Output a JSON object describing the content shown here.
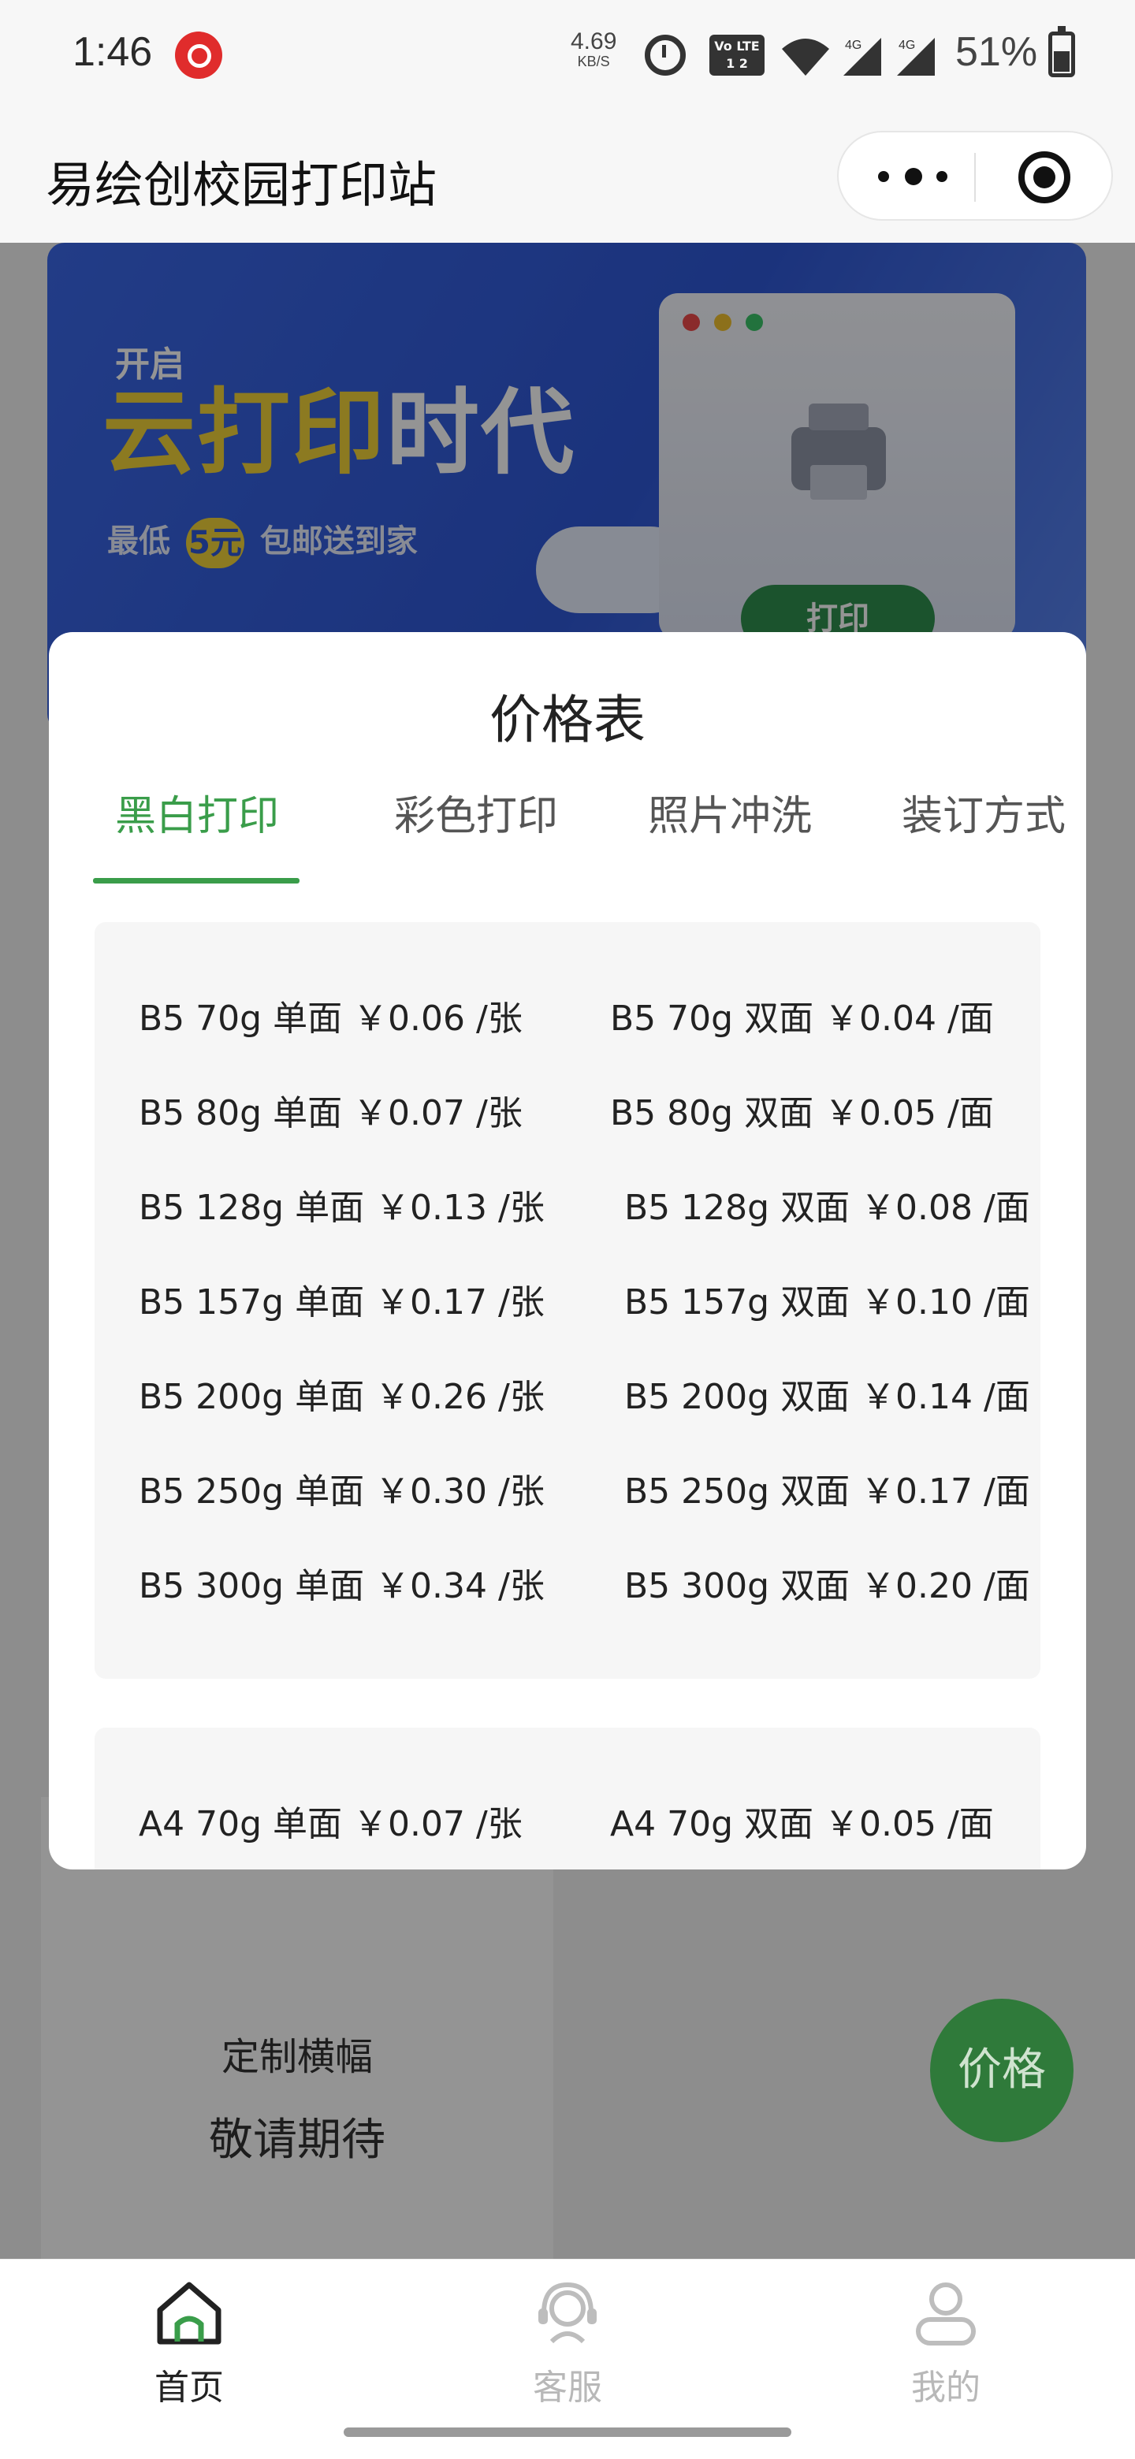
{
  "status_bar": {
    "time": "1:46",
    "net_speed": "4.69",
    "net_speed_unit": "KB/S",
    "volte_label": "Vo LTE 1 2",
    "signal_label_1": "4G",
    "signal_label_2": "4G",
    "battery": "51%"
  },
  "nav": {
    "title": "易绘创校园打印站"
  },
  "banner": {
    "small_text": "开启",
    "headline_highlight": "云打印",
    "headline_rest": "时代",
    "sub_prefix": "最低",
    "sub_coin": "5元",
    "sub_suffix": "包邮送到家",
    "print_button": "打印"
  },
  "background_card": {
    "title": "定制横幅",
    "subtitle": "敬请期待"
  },
  "modal": {
    "title": "价格表",
    "tabs": [
      {
        "label": "黑白打印",
        "active": true
      },
      {
        "label": "彩色打印",
        "active": false
      },
      {
        "label": "照片冲洗",
        "active": false
      },
      {
        "label": "装订方式",
        "active": false
      }
    ],
    "b5_rows": [
      {
        "single": "B5 70g 单面 ￥0.06 /张",
        "double": "B5 70g 双面 ￥0.04 /面"
      },
      {
        "single": "B5 80g 单面 ￥0.07 /张",
        "double": "B5 80g 双面 ￥0.05 /面"
      },
      {
        "single": "B5 128g 单面 ￥0.13 /张",
        "double": "B5 128g 双面 ￥0.08 /面"
      },
      {
        "single": "B5 157g 单面 ￥0.17 /张",
        "double": "B5 157g 双面 ￥0.10 /面"
      },
      {
        "single": "B5 200g 单面 ￥0.26 /张",
        "double": "B5 200g 双面 ￥0.14 /面"
      },
      {
        "single": "B5 250g 单面 ￥0.30 /张",
        "double": "B5 250g 双面 ￥0.17 /面"
      },
      {
        "single": "B5 300g 单面 ￥0.34 /张",
        "double": "B5 300g 双面 ￥0.20 /面"
      }
    ],
    "a4_rows": [
      {
        "single": "A4 70g 单面 ￥0.07 /张",
        "double": "A4 70g 双面 ￥0.05 /面"
      }
    ]
  },
  "fab": {
    "label": "价格"
  },
  "tab_bar": {
    "items": [
      {
        "label": "首页",
        "icon": "home-icon",
        "active": true
      },
      {
        "label": "客服",
        "icon": "headset-icon",
        "active": false
      },
      {
        "label": "我的",
        "icon": "user-icon",
        "active": false
      }
    ]
  },
  "colors": {
    "accent_green": "#3a9d4a",
    "fab_green": "#2f7a3a",
    "banner_blue": "#2f58d6",
    "banner_yellow": "#f2d23a"
  }
}
